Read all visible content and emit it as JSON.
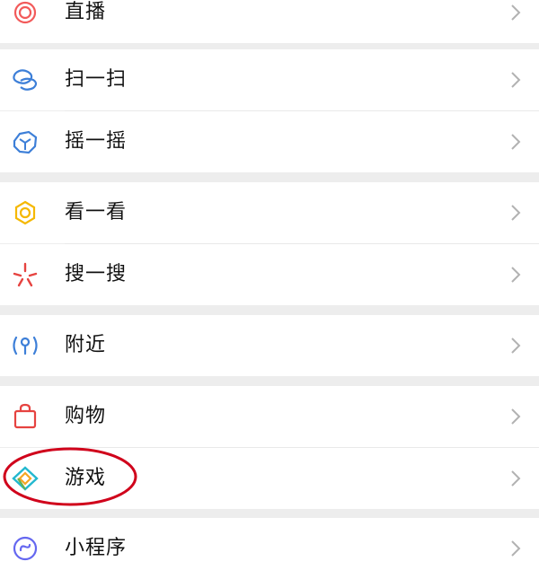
{
  "menu": {
    "items": [
      {
        "label": "直播",
        "icon": "live-icon"
      },
      {
        "label": "扫一扫",
        "icon": "scan-icon"
      },
      {
        "label": "摇一摇",
        "icon": "shake-icon"
      },
      {
        "label": "看一看",
        "icon": "look-icon"
      },
      {
        "label": "搜一搜",
        "icon": "search-icon"
      },
      {
        "label": "附近",
        "icon": "nearby-icon"
      },
      {
        "label": "购物",
        "icon": "shopping-bag-icon"
      },
      {
        "label": "游戏",
        "icon": "game-icon"
      },
      {
        "label": "小程序",
        "icon": "mini-program-icon"
      }
    ]
  },
  "colors": {
    "background": "#ededed",
    "row": "#ffffff",
    "chevron": "#b2b2b2",
    "annotation": "#d0021b",
    "live": "#f25a5a",
    "scan": "#3d7fd8",
    "look": "#f5b800",
    "search": "#e64340",
    "game_cyan": "#22b8cf",
    "game_orange": "#f5a623",
    "mini_program": "#6467f0"
  }
}
